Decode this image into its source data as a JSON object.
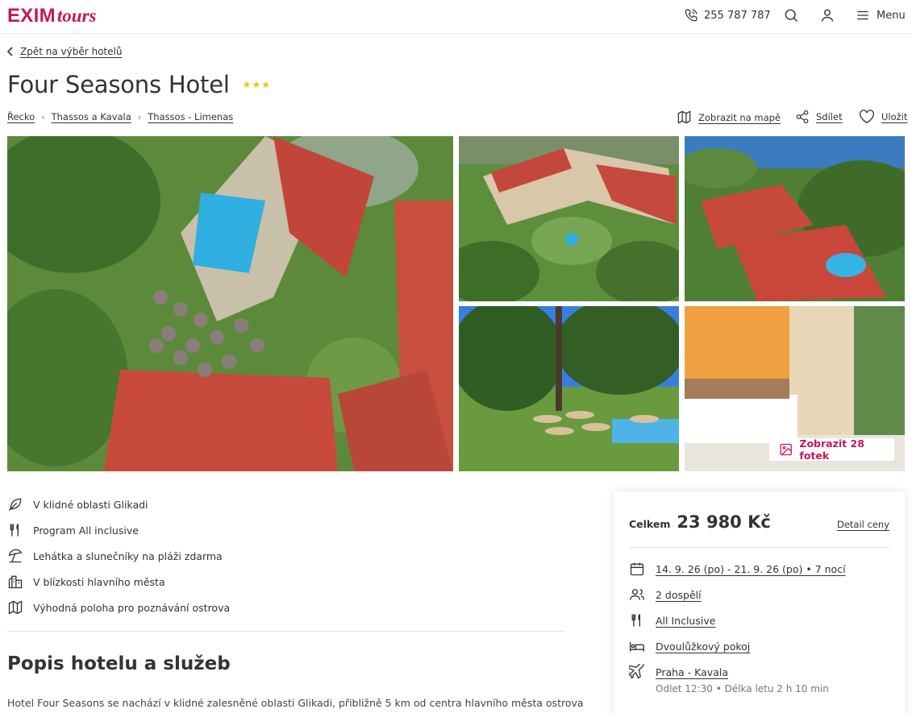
{
  "header": {
    "logo_main": "EXIM",
    "logo_script": "tours",
    "phone": "255 787 787",
    "menu_label": "Menu"
  },
  "back_link": "Zpět na výběr hotelů",
  "hotel": {
    "name": "Four Seasons Hotel",
    "stars": 3
  },
  "breadcrumb": [
    "Řecko",
    "Thassos a Kavala",
    "Thassos - Limenas"
  ],
  "actions": {
    "map": "Zobrazit na mapě",
    "share": "Sdílet",
    "save": "Uložit"
  },
  "gallery": {
    "show_photos": "Zobrazit 28 fotek"
  },
  "features": [
    {
      "icon": "leaf-icon",
      "text": "V klidné oblasti Glikadi"
    },
    {
      "icon": "cutlery-icon",
      "text": "Program All inclusive"
    },
    {
      "icon": "beach-umbrella-icon",
      "text": "Lehátka a slunečníky na pláži zdarma"
    },
    {
      "icon": "city-icon",
      "text": "V blízkosti hlavního města"
    },
    {
      "icon": "map-icon",
      "text": "Výhodná poloha pro poznávání ostrova"
    }
  ],
  "description": {
    "title": "Popis hotelu a služeb",
    "text": "Hotel Four Seasons se nachází v klidné zalesněné oblasti Glikadi, přibližně 5 km od centra hlavního města ostrova"
  },
  "price": {
    "label": "Celkem",
    "value": "23 980 Kč",
    "detail": "Detail ceny",
    "dates": "14. 9. 26 (po) - 21. 9. 26 (po) • 7 nocí",
    "people": "2 dospělí",
    "board": "All Inclusive",
    "room": "Dvoulůžkový pokoj",
    "flight": "Praha - Kavala",
    "flight_info": "Odlet 12:30 • Délka letu 2 h 10 min"
  },
  "colors": {
    "brand": "#c2185b",
    "star": "#f2c200"
  }
}
